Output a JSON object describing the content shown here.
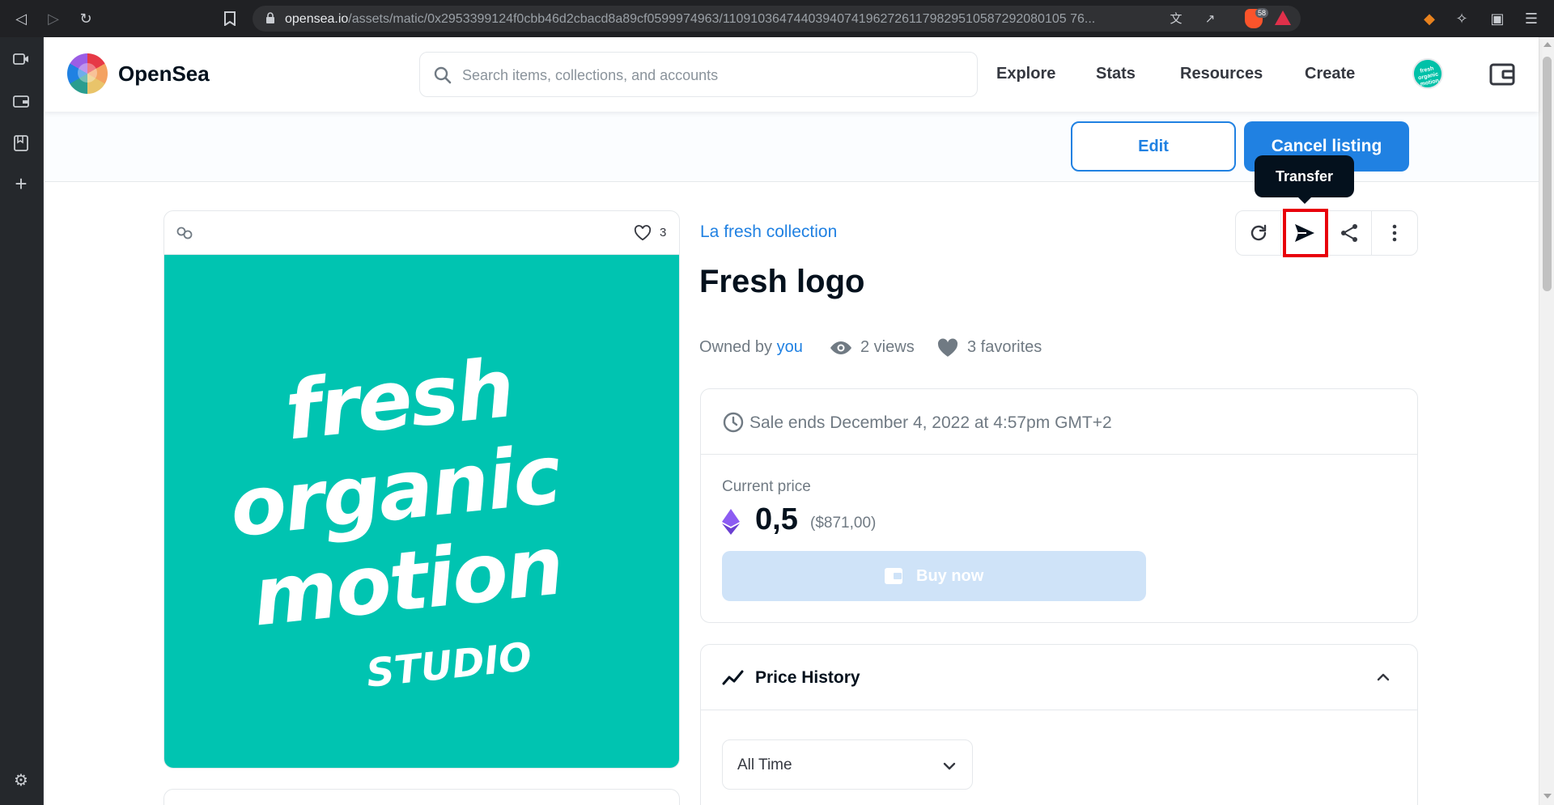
{
  "browser": {
    "url_host": "opensea.io",
    "url_path": "/assets/matic/0x2953399124f0cbb46d2cbacd8a89cf0599974963/110910364744039407419627261179829510587292080105 76...",
    "brave_shield_count": "58"
  },
  "header": {
    "brand": "OpenSea",
    "search_placeholder": "Search items, collections, and accounts",
    "nav": [
      "Explore",
      "Stats",
      "Resources",
      "Create"
    ],
    "avatar_text": "fresh organic motion"
  },
  "actions": {
    "edit_label": "Edit",
    "cancel_label": "Cancel listing",
    "tooltip": "Transfer"
  },
  "asset": {
    "favorite_count": "3",
    "art_lines": [
      "fresh",
      "organic",
      "motion",
      "STUDIO"
    ],
    "collection": "La fresh collection",
    "title": "Fresh logo",
    "owned_by_label": "Owned by",
    "owner": "you",
    "views": "2 views",
    "favorites": "3 favorites"
  },
  "sale": {
    "ends": "Sale ends December 4, 2022 at 4:57pm GMT+2",
    "current_price_label": "Current price",
    "price": "0,5",
    "price_usd": "($871,00)",
    "buy_label": "Buy now"
  },
  "price_history": {
    "title": "Price History",
    "range_selected": "All Time"
  },
  "colors": {
    "accent": "#2081e2",
    "artwork_bg": "#00c4b1",
    "highlight": "#e8000a"
  }
}
